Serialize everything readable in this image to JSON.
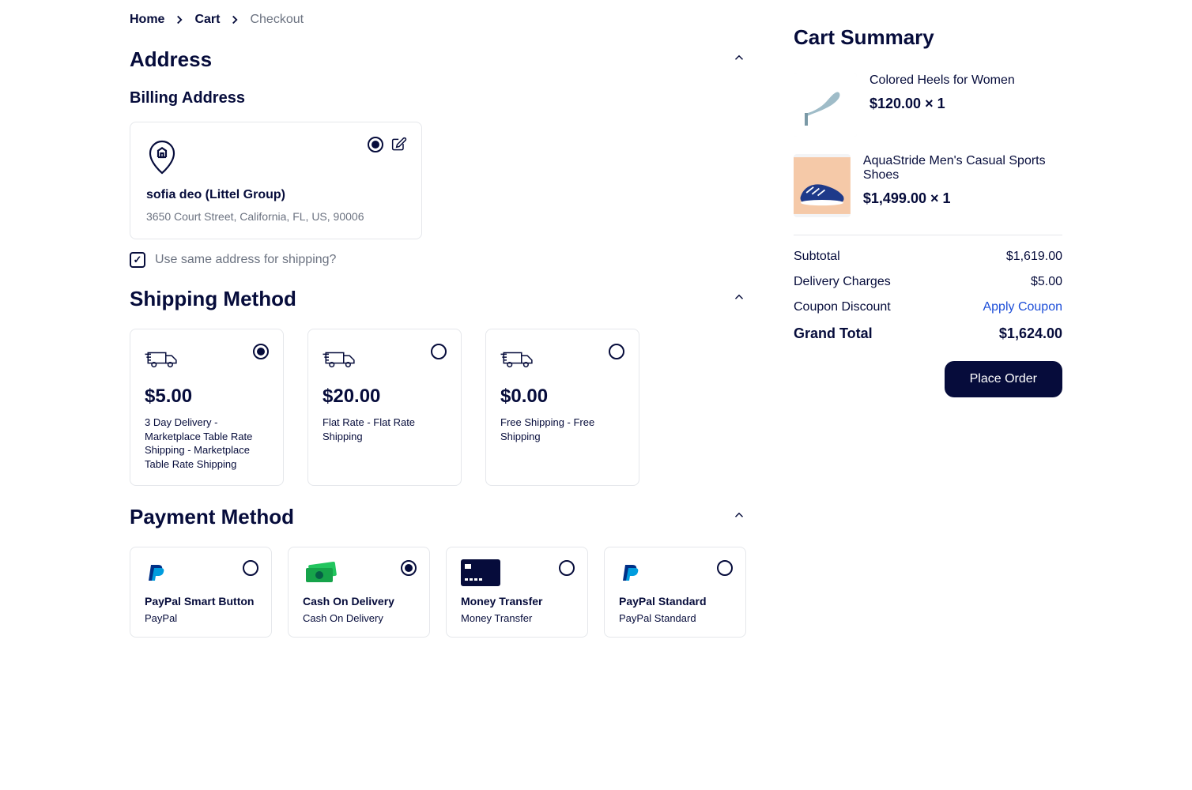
{
  "breadcrumb": {
    "home": "Home",
    "cart": "Cart",
    "checkout": "Checkout"
  },
  "sections": {
    "address_title": "Address",
    "billing_title": "Billing Address",
    "shipping_title": "Shipping Method",
    "payment_title": "Payment Method"
  },
  "billing": {
    "name": "sofia deo (Littel Group)",
    "line": "3650 Court Street, California, FL, US, 90006",
    "same_address_label": "Use same address for shipping?"
  },
  "shipping_options": [
    {
      "price": "$5.00",
      "desc": "3 Day Delivery - Marketplace Table Rate Shipping - Marketplace Table Rate Shipping",
      "selected": true
    },
    {
      "price": "$20.00",
      "desc": "Flat Rate - Flat Rate Shipping",
      "selected": false
    },
    {
      "price": "$0.00",
      "desc": "Free Shipping - Free Shipping",
      "selected": false
    }
  ],
  "payment_options": [
    {
      "title": "PayPal Smart Button",
      "sub": "PayPal",
      "selected": false,
      "icon": "paypal"
    },
    {
      "title": "Cash On Delivery",
      "sub": "Cash On Delivery",
      "selected": true,
      "icon": "cash"
    },
    {
      "title": "Money Transfer",
      "sub": "Money Transfer",
      "selected": false,
      "icon": "card"
    },
    {
      "title": "PayPal Standard",
      "sub": "PayPal Standard",
      "selected": false,
      "icon": "paypal"
    }
  ],
  "summary": {
    "title": "Cart Summary",
    "items": [
      {
        "name": "Colored Heels for Women",
        "price": "$120.00",
        "qty": "1"
      },
      {
        "name": "AquaStride Men's Casual Sports Shoes",
        "price": "$1,499.00",
        "qty": "1"
      }
    ],
    "subtotal_label": "Subtotal",
    "subtotal": "$1,619.00",
    "delivery_label": "Delivery Charges",
    "delivery": "$5.00",
    "coupon_label": "Coupon Discount",
    "apply_coupon": "Apply Coupon",
    "grand_label": "Grand Total",
    "grand": "$1,624.00",
    "place_order": "Place Order"
  }
}
